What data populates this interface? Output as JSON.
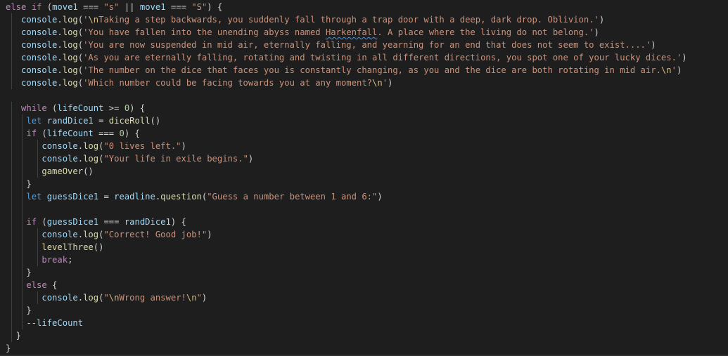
{
  "editor": {
    "language": "javascript",
    "theme_bg": "#1e1e1e",
    "lines": [
      "else if (move1 === \"s\" || move1 === \"S\") {",
      "console.log('\\nTaking a step backwards, you suddenly fall through a trap door with a deep, dark drop. Oblivion.')",
      "console.log('You have fallen into the unending abyss named Harkenfall. A place where the living do not belong.')",
      "console.log('You are now suspended in mid air, eternally falling, and yearning for an end that does not seem to exist....')",
      "console.log('As you are eternally falling, rotating and twisting in all different directions, you spot one of your lucky dices.')",
      "console.log('The number on the dice that faces you is constantly changing, as you and the dice are both rotating in mid air.\\n')",
      "console.log('Which number could be facing towards you at any moment?\\n')",
      "",
      "while (lifeCount >= 0) {",
      "let randDice1 = diceRoll()",
      "if (lifeCount === 0) {",
      "console.log(\"0 lives left.\")",
      "console.log(\"Your life in exile begins.\")",
      "gameOver()",
      "}",
      "let guessDice1 = readline.question(\"Guess a number between 1 and 6:\")",
      "",
      "if (guessDice1 === randDice1) {",
      "console.log(\"Correct! Good job!\")",
      "levelThree()",
      "break;",
      "}",
      "else {",
      "console.log(\"\\nWrong answer!\\n\")",
      "}",
      "--lifeCount",
      "}",
      "}"
    ],
    "squiggle_word": "Harkenfall"
  }
}
